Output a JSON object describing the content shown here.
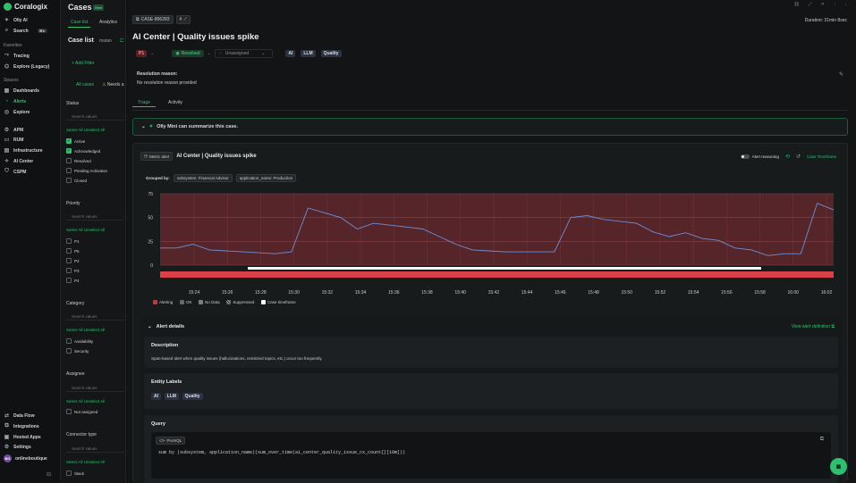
{
  "sidebar": {
    "brand": "Coralogix",
    "olly": "Olly AI",
    "search": "Search",
    "search_kbd": "⌘K",
    "favorites_label": "Favorites",
    "favorites": [
      "Tracing",
      "Explore (Legacy)"
    ],
    "spaces_label": "Spaces",
    "spaces": [
      "Dashboards",
      "Alerts",
      "Explore"
    ],
    "modules": [
      "APM",
      "RUM",
      "Infrastructure",
      "AI Center",
      "CSPM"
    ],
    "bottom": [
      "Data Flow",
      "Integrations",
      "Hosted Apps",
      "Settings"
    ],
    "user_initials": "BO",
    "user": "onlineboutique"
  },
  "caselist": {
    "title": "Cases",
    "new_badge": "New",
    "tabs": [
      "Case list",
      "Analytics"
    ],
    "subtitle": "Case list",
    "user": "matan",
    "add_filter": "+ Add Filter",
    "quick_tabs": [
      "All cases",
      "Needs a"
    ],
    "search_placeholder": "Search values",
    "select_all": "Select All",
    "unselect_all": "Unselect All",
    "status_label": "Status",
    "statuses": [
      {
        "label": "Active",
        "checked": true
      },
      {
        "label": "Acknowledged",
        "checked": true
      },
      {
        "label": "Resolved",
        "checked": false
      },
      {
        "label": "Pending Activation",
        "checked": false
      },
      {
        "label": "Closed",
        "checked": false
      }
    ],
    "priority_label": "Priority",
    "priorities": [
      "P1",
      "P5",
      "P2",
      "P3",
      "P4"
    ],
    "category_label": "Category",
    "categories": [
      "Availability",
      "Security"
    ],
    "assignee_label": "Assignee",
    "assignees": [
      "Not assigned"
    ],
    "connector_label": "Connector type",
    "connectors": [
      "Slack"
    ]
  },
  "case": {
    "id": "CASE-806283",
    "duration_label": "Duration:",
    "duration": "31min 8sec",
    "title": "AI Center | Quality issues spike",
    "priority": "P1",
    "status": "Resolved",
    "assignee": "Unassigned",
    "labels": [
      "AI",
      "LLM",
      "Quality"
    ],
    "resolution_reason_label": "Resolution reason:",
    "resolution_reason": "No resolution reason provided",
    "tabs": [
      "Triage",
      "Activity"
    ],
    "olly_summary": "Olly Mini can summarize this case."
  },
  "alert": {
    "type_chip": "Metric alert",
    "title": "AI Center | Quality issues spike",
    "reasoning_label": "Alert reasoning",
    "timeframe_link": "Case Timeframe",
    "grouped_by_label": "Grouped by:",
    "groups": [
      "subsystem: Financial Advisor",
      "application_name: Production"
    ],
    "legend": [
      {
        "label": "Alerting",
        "color": "#c0393f"
      },
      {
        "label": "OK",
        "color": "#5f6b6e"
      },
      {
        "label": "No Data",
        "color": "#7a7f82"
      },
      {
        "label": "Suppressed",
        "color": "#9da3a6"
      },
      {
        "label": "Case timeframe",
        "color": "#ffffff"
      }
    ],
    "details_label": "Alert details",
    "view_definition": "View alert definition",
    "description_label": "Description",
    "description": "Span-based alert when quality issues (hallucinations, restricted topics, etc.) occur too frequently.",
    "entity_labels_label": "Entity Labels",
    "entity_labels": [
      "AI",
      "LLM",
      "Quality"
    ],
    "query_label": "Query",
    "query_lang": "PromQL",
    "query": "sum by (subsystem, application_name)(sum_over_time(ai_center_quality_issue_cx_count{}[10m]))"
  },
  "chart_data": {
    "type": "line",
    "x": [
      "15:24",
      "15:26",
      "15:28",
      "15:30",
      "15:32",
      "15:34",
      "15:36",
      "15:38",
      "15:40",
      "15:42",
      "15:44",
      "15:46",
      "15:48",
      "15:50",
      "15:52",
      "15:54",
      "15:56",
      "15:58",
      "16:00",
      "16:02"
    ],
    "y_ticks": [
      0,
      25,
      50,
      75
    ],
    "ylim": [
      0,
      75
    ],
    "series": [
      {
        "values": [
          18,
          18,
          22,
          16,
          15,
          14,
          13,
          12,
          14,
          60,
          55,
          50,
          38,
          44,
          42,
          40,
          38,
          30,
          22,
          16,
          15,
          14,
          14,
          14,
          14,
          50,
          52,
          48,
          46,
          44,
          35,
          30,
          34,
          28,
          26,
          18,
          16,
          10,
          12,
          12,
          65,
          58
        ]
      }
    ],
    "colors": {
      "line": "#6d8fd6",
      "alert_band": "#6a2a2f",
      "alert_bar": "#d94048",
      "timeframe": "#ffffff"
    }
  }
}
